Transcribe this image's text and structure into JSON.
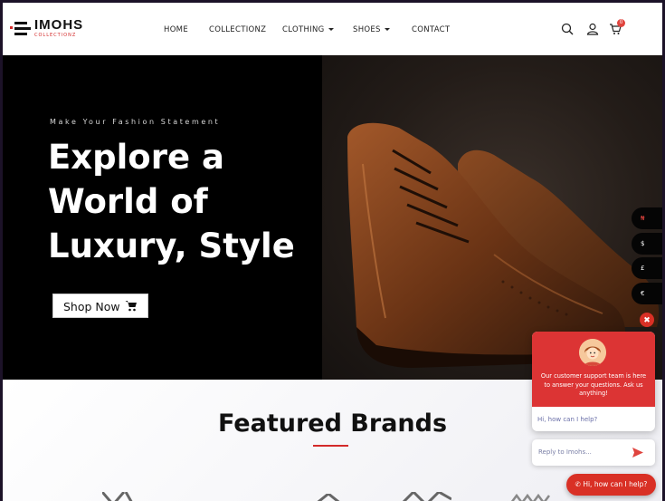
{
  "header": {
    "logo_name": "IMOHS",
    "logo_sub": "COLLECTIONZ",
    "nav": [
      {
        "label": "HOME"
      },
      {
        "label": "COLLECTIONZ"
      },
      {
        "label": "CLOTHING"
      },
      {
        "label": "SHOES"
      },
      {
        "label": "CONTACT"
      }
    ],
    "cart_count": "0"
  },
  "hero": {
    "tagline": "Make Your Fashion Statement",
    "title_line1": "Explore a",
    "title_line2": "World of",
    "title_line3": "Luxury, Style",
    "cta": "Shop Now"
  },
  "currencies": [
    "₦",
    "$",
    "£",
    "€"
  ],
  "featured": {
    "title": "Featured Brands"
  },
  "chat": {
    "message": "Our customer support team is here to answer your questions. Ask us anything!",
    "quick_reply": "Hi, how can I help?",
    "reply_placeholder": "Reply to Imohs...",
    "pill": "Hi, how can I help?"
  },
  "colors": {
    "accent_red": "#d93025",
    "hero_bg": "#000000"
  }
}
